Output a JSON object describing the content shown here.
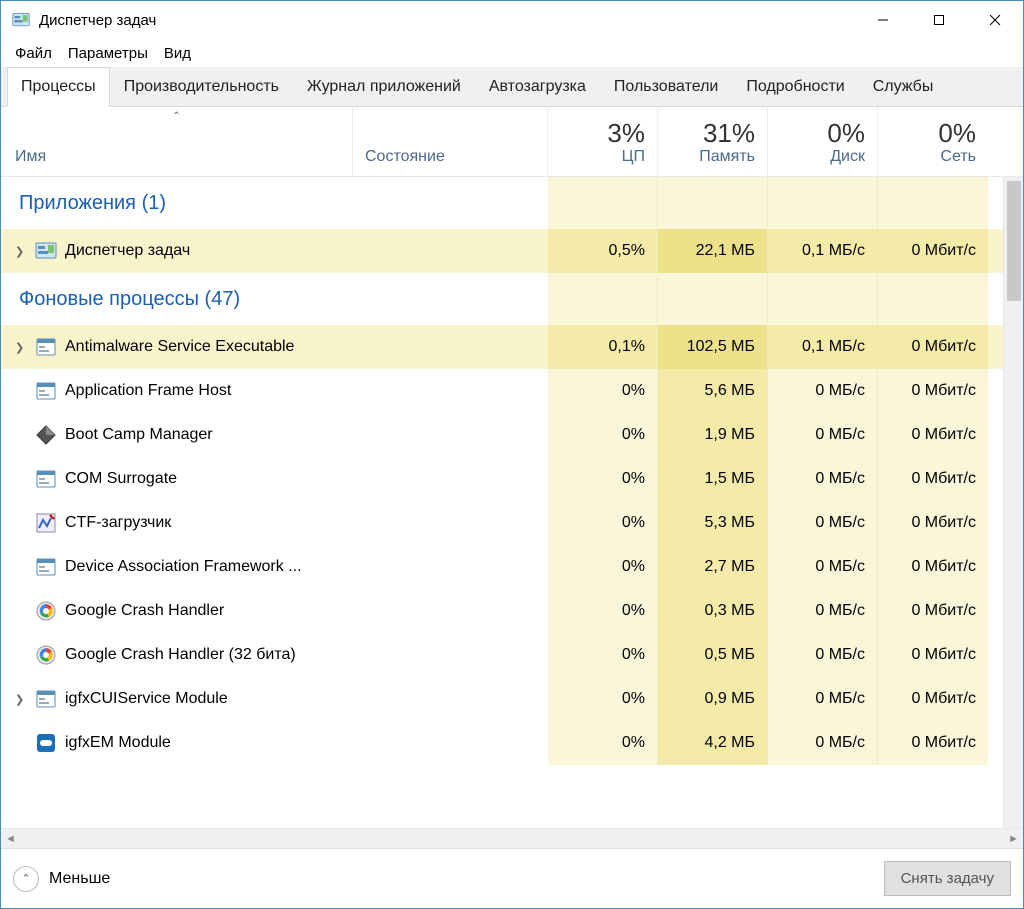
{
  "title": "Диспетчер задач",
  "menus": [
    "Файл",
    "Параметры",
    "Вид"
  ],
  "tabs": [
    "Процессы",
    "Производительность",
    "Журнал приложений",
    "Автозагрузка",
    "Пользователи",
    "Подробности",
    "Службы"
  ],
  "activeTab": 0,
  "cols": {
    "name": "Имя",
    "state": "Состояние",
    "cpu": {
      "pct": "3%",
      "label": "ЦП"
    },
    "mem": {
      "pct": "31%",
      "label": "Память"
    },
    "disk": {
      "pct": "0%",
      "label": "Диск"
    },
    "net": {
      "pct": "0%",
      "label": "Сеть"
    }
  },
  "groups": {
    "apps": "Приложения (1)",
    "bg": "Фоновые процессы (47)"
  },
  "rows": [
    {
      "exp": true,
      "icon": "taskmgr",
      "name": "Диспетчер задач",
      "cpu": "0,5%",
      "mem": "22,1 МБ",
      "disk": "0,1 МБ/с",
      "net": "0 Мбит/с",
      "hl": true
    },
    {
      "exp": true,
      "icon": "app",
      "name": "Antimalware Service Executable",
      "cpu": "0,1%",
      "mem": "102,5 МБ",
      "disk": "0,1 МБ/с",
      "net": "0 Мбит/с",
      "hl": true
    },
    {
      "exp": false,
      "icon": "app",
      "name": "Application Frame Host",
      "cpu": "0%",
      "mem": "5,6 МБ",
      "disk": "0 МБ/с",
      "net": "0 Мбит/с"
    },
    {
      "exp": false,
      "icon": "diamond",
      "name": "Boot Camp Manager",
      "cpu": "0%",
      "mem": "1,9 МБ",
      "disk": "0 МБ/с",
      "net": "0 Мбит/с"
    },
    {
      "exp": false,
      "icon": "app",
      "name": "COM Surrogate",
      "cpu": "0%",
      "mem": "1,5 МБ",
      "disk": "0 МБ/с",
      "net": "0 Мбит/с"
    },
    {
      "exp": false,
      "icon": "ctf",
      "name": "CTF-загрузчик",
      "cpu": "0%",
      "mem": "5,3 МБ",
      "disk": "0 МБ/с",
      "net": "0 Мбит/с"
    },
    {
      "exp": false,
      "icon": "app",
      "name": "Device Association Framework ...",
      "cpu": "0%",
      "mem": "2,7 МБ",
      "disk": "0 МБ/с",
      "net": "0 Мбит/с"
    },
    {
      "exp": false,
      "icon": "google",
      "name": "Google Crash Handler",
      "cpu": "0%",
      "mem": "0,3 МБ",
      "disk": "0 МБ/с",
      "net": "0 Мбит/с"
    },
    {
      "exp": false,
      "icon": "google",
      "name": "Google Crash Handler (32 бита)",
      "cpu": "0%",
      "mem": "0,5 МБ",
      "disk": "0 МБ/с",
      "net": "0 Мбит/с"
    },
    {
      "exp": true,
      "icon": "app",
      "name": "igfxCUIService Module",
      "cpu": "0%",
      "mem": "0,9 МБ",
      "disk": "0 МБ/с",
      "net": "0 Мбит/с"
    },
    {
      "exp": false,
      "icon": "intel",
      "name": "igfxEM Module",
      "cpu": "0%",
      "mem": "4,2 МБ",
      "disk": "0 МБ/с",
      "net": "0 Мбит/с"
    }
  ],
  "footer": {
    "fewer": "Меньше",
    "endtask": "Снять задачу"
  }
}
